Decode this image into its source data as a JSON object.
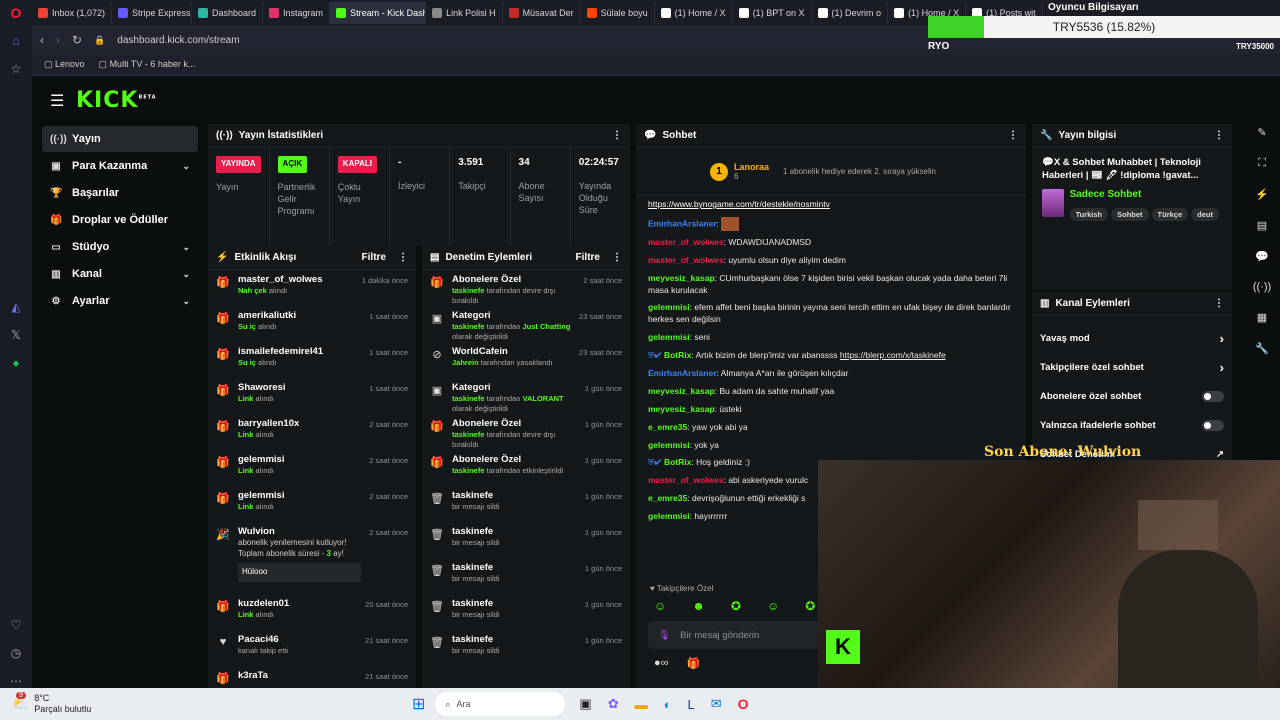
{
  "browser": {
    "tabs": [
      {
        "label": "Inbox (1,072)",
        "color": "#ea4335"
      },
      {
        "label": "Stripe Express",
        "color": "#635bff"
      },
      {
        "label": "Dashboard",
        "color": "#2fb5a0"
      },
      {
        "label": "Instagram",
        "color": "#e1306c"
      },
      {
        "label": "Stream - Kick Dashbo",
        "color": "#53fc18",
        "active": true
      },
      {
        "label": "Link Polisi H",
        "color": "#888"
      },
      {
        "label": "Müsavat Der",
        "color": "#c62828"
      },
      {
        "label": "Sülale boyu",
        "color": "#ff4500"
      },
      {
        "label": "(1) Home / X",
        "color": "#ffffff"
      },
      {
        "label": "(1) BPT on X",
        "color": "#ffffff"
      },
      {
        "label": "(1) Devrim o",
        "color": "#ffffff"
      },
      {
        "label": "(1) Home / X",
        "color": "#ffffff"
      },
      {
        "label": "(1) Posts wit",
        "color": "#ffffff"
      }
    ],
    "url": "dashboard.kick.com/stream",
    "bookmarks": [
      "Lenovo",
      "Multi TV - 6 haber k..."
    ]
  },
  "overlay": {
    "title": "Oyuncu Bilgisayarı",
    "currency": "TRY5536 (15.82%)",
    "left_label": "RYO",
    "right_label": "TRY35000",
    "progress": 0.1582,
    "last_sub": "Son Abone: Wulvion"
  },
  "sidebar": {
    "items": [
      {
        "label": "Yayın",
        "icon": "broadcast-icon",
        "active": true
      },
      {
        "label": "Para Kazanma",
        "icon": "money-icon",
        "chevron": true
      },
      {
        "label": "Başarılar",
        "icon": "trophy-icon"
      },
      {
        "label": "Droplar ve Ödüller",
        "icon": "gift-icon"
      },
      {
        "label": "Stüdyo",
        "icon": "studio-icon",
        "chevron": true
      },
      {
        "label": "Kanal",
        "icon": "channel-icon",
        "chevron": true
      },
      {
        "label": "Ayarlar",
        "icon": "gear-icon",
        "chevron": true
      }
    ]
  },
  "stats": {
    "title": "Yayın İstatistikleri",
    "cells": [
      {
        "badge": "YAYINDA",
        "badge_color": "#e91e4c",
        "label": "Yayın"
      },
      {
        "badge": "AÇIK",
        "badge_color": "#53fc18",
        "label": "Partnerlik Gelir Programı"
      },
      {
        "badge": "KAPALI",
        "badge_color": "#e91e4c",
        "label": "Çoklu Yayın"
      },
      {
        "value": "-",
        "label": "İzleyici"
      },
      {
        "value": "3.591",
        "label": "Takipçi"
      },
      {
        "value": "34",
        "label": "Abone Sayısı"
      },
      {
        "value": "02:24:57",
        "label": "Yayında Olduğu Süre"
      }
    ]
  },
  "activity": {
    "title": "Etkinlik Akışı",
    "filter": "Filtre",
    "items": [
      {
        "name": "master_of_wolwes",
        "sub_bold": "Nah çek",
        "sub": "alındı",
        "time": "1 dakika önce"
      },
      {
        "name": "amerikaliutki",
        "sub_bold": "Su iç",
        "sub": "alındı",
        "time": "1 saat önce"
      },
      {
        "name": "ismailefedemirel41",
        "sub_bold": "Su iç",
        "sub": "alındı",
        "time": "1 saat önce"
      },
      {
        "name": "Shaworesi",
        "sub_bold": "Link",
        "sub": "alındı",
        "time": "1 saat önce"
      },
      {
        "name": "barryallen10x",
        "sub_bold": "Link",
        "sub": "alındı",
        "time": "2 saat önce"
      },
      {
        "name": "gelemmisi",
        "sub_bold": "Link",
        "sub": "alındı",
        "time": "2 saat önce"
      },
      {
        "name": "gelemmisi",
        "sub_bold": "Link",
        "sub": "alındı",
        "time": "2 saat önce"
      }
    ],
    "sub_item": {
      "name": "Wulvion",
      "text_a": "abonelik yenilemesini kutluyor! Toplam abonelik süresi - ",
      "months": "3",
      "text_b": " ay!",
      "msg": "Hülooo",
      "time": "2 saat önce"
    },
    "after": [
      {
        "name": "kuzdelen01",
        "sub_bold": "Link",
        "sub": "alındı",
        "time": "20 saat önce"
      },
      {
        "name": "Pacaci46",
        "sub_bold": "",
        "sub": "kanalı takip etti",
        "time": "21 saat önce"
      },
      {
        "name": "k3raTa",
        "sub_bold": "",
        "sub": "",
        "time": "21 saat önce"
      }
    ]
  },
  "moderation": {
    "title": "Denetim Eylemleri",
    "filter": "Filtre",
    "items": [
      {
        "name": "Abonelere Özel",
        "actor": "taskinefe",
        "text": "tarafından devre dışı bırakıldı",
        "time": "2 saat önce",
        "icon": "gift-icon"
      },
      {
        "name": "Kategori",
        "actor": "taskinefe",
        "text": "tarafından",
        "cat": "Just Chatting",
        "text2": "olarak değiştirildi",
        "time": "23 saat önce",
        "icon": "category-icon"
      },
      {
        "name": "WorldCafein",
        "actor": "Jahrein",
        "text": "tarafından yasaklandı",
        "time": "23 saat önce",
        "icon": "ban-icon"
      },
      {
        "name": "Kategori",
        "actor": "taskinefe",
        "text": "tarafından",
        "cat": "VALORANT",
        "text2": "olarak değiştirildi",
        "time": "1 gün önce",
        "icon": "category-icon"
      },
      {
        "name": "Abonelere Özel",
        "actor": "taskinefe",
        "text": "tarafından devre dışı bırakıldı",
        "time": "1 gün önce",
        "icon": "gift-icon"
      },
      {
        "name": "Abonelere Özel",
        "actor": "taskinefe",
        "text": "tarafından etkinleştirildi",
        "time": "1 gün önce",
        "icon": "gift-icon"
      },
      {
        "name": "taskinefe",
        "actor": "",
        "text": "bir mesajı sildi",
        "time": "1 gün önce",
        "icon": "trash-icon"
      },
      {
        "name": "taskinefe",
        "actor": "",
        "text": "bir mesajı sildi",
        "time": "1 gün önce",
        "icon": "trash-icon"
      },
      {
        "name": "taskinefe",
        "actor": "",
        "text": "bir mesajı sildi",
        "time": "1 gün önce",
        "icon": "trash-icon"
      },
      {
        "name": "taskinefe",
        "actor": "",
        "text": "bir mesajı sildi",
        "time": "1 gün önce",
        "icon": "trash-icon"
      },
      {
        "name": "taskinefe",
        "actor": "",
        "text": "bir mesajı sildi",
        "time": "1 gün önce",
        "icon": "trash-icon"
      }
    ]
  },
  "chat": {
    "title": "Sohbet",
    "pinned_user": "Lanoraa",
    "pinned_count": "6",
    "pinned_text": "1 abonelik hediye ederek 2. sıraya yükselin",
    "messages": [
      {
        "user": "",
        "color": "#53fc18",
        "text": "https://www.bynogame.com/tr/destekle/nosmintv",
        "link": true
      },
      {
        "user": "EmirhanArslaner",
        "color": "#3b82f6",
        "text": ""
      },
      {
        "user": "master_of_wolwes",
        "color": "#e91e4c",
        "text": "WDAWDIJANADMSD"
      },
      {
        "user": "master_of_wolwes",
        "color": "#e91e4c",
        "text": "uyumlu olsun diye aliyim dedim"
      },
      {
        "user": "meyvesiz_kasap",
        "color": "#53fc18",
        "text": "CUmhurbaşkanı ölse 7 kişiden birisi vekil başkan olucak yada daha beteri 7li masa kurulacak"
      },
      {
        "user": "gelemmisi",
        "color": "#53fc18",
        "text": "efem affet beni başka birinin yayına seni tercih ettim en ufak bişey de direk banlardır herkes sen değilsin"
      },
      {
        "user": "gelemmisi",
        "color": "#53fc18",
        "text": "seni"
      },
      {
        "user": "BotRix",
        "color": "#53fc18",
        "text": "Artık bizim de blerp'imiz var abanssss ",
        "link_text": "https://blerp.com/x/taskinefe"
      },
      {
        "user": "EmirhanArslaner",
        "color": "#3b82f6",
        "text": "Almanya A*arı ile görüşen kılıçdar"
      },
      {
        "user": "meyvesiz_kasap",
        "color": "#53fc18",
        "text": "Bu adam da sahte muhalif yaa"
      },
      {
        "user": "meyvesiz_kasap",
        "color": "#53fc18",
        "text": "üsteki"
      },
      {
        "user": "e_emre35",
        "color": "#53fc18",
        "text": "yaw yok abi ya"
      },
      {
        "user": "gelemmisi",
        "color": "#53fc18",
        "text": "yok ya"
      },
      {
        "user": "BotRix",
        "color": "#53fc18",
        "text": "Hoş geldiniz :)"
      },
      {
        "user": "master_of_wolwes",
        "color": "#e91e4c",
        "text": "abi askeriyede vurulc"
      },
      {
        "user": "e_emre35",
        "color": "#53fc18",
        "text": "devrişoğlunun ettiği erkekliği s"
      },
      {
        "user": "gelemmisi",
        "color": "#53fc18",
        "text": "hayırrrrrr"
      }
    ],
    "followers_only": "Takipçilere Özel",
    "placeholder": "Bir mesaj gönderin"
  },
  "stream_info": {
    "title": "Yayın bilgisi",
    "stream_title": "💬X & Sohbet Muhabbet | Teknoloji Haberleri | 📰 🖊 !diploma !gavat...",
    "category": "Sadece Sohbet",
    "tags": [
      "Turkish",
      "Sohbet",
      "Türkçe",
      "deut"
    ]
  },
  "channel_actions": {
    "title": "Kanal Eylemleri",
    "rows": [
      {
        "label": "Yavaş mod",
        "type": "arrow"
      },
      {
        "label": "Takipçilere özel sohbet",
        "type": "arrow"
      },
      {
        "label": "Abonelere özel sohbet",
        "type": "toggle"
      },
      {
        "label": "Yalnızca ifadelerle sohbet",
        "type": "toggle"
      },
      {
        "label": "Sohbet Denetimi",
        "type": "link"
      }
    ]
  },
  "taskbar": {
    "temp": "8°C",
    "weather": "Parçalı bulutlu",
    "badge": "9",
    "search": "Ara"
  }
}
